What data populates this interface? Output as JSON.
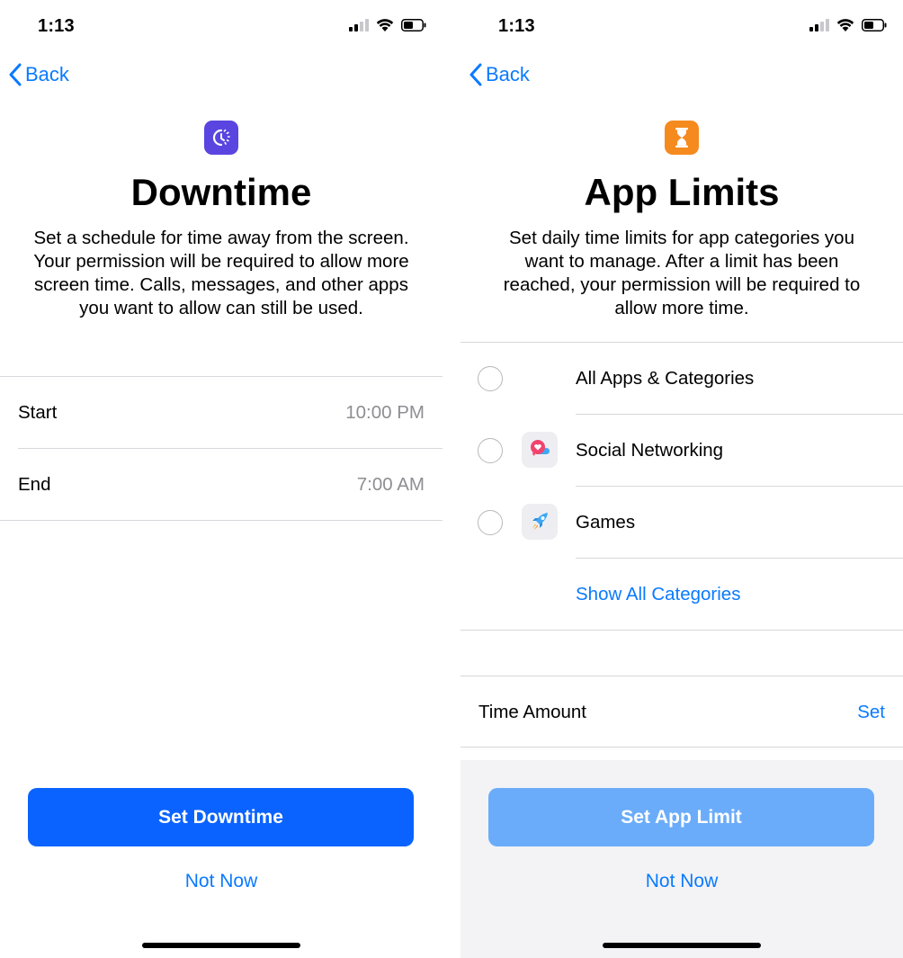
{
  "left_screen": {
    "status": {
      "time": "1:13"
    },
    "nav": {
      "back_label": "Back"
    },
    "icon": {
      "name": "downtime-icon",
      "color": "#5a45e0"
    },
    "title": "Downtime",
    "description": "Set a schedule for time away from the screen. Your permission will be required to allow more screen time. Calls, messages, and other apps you want to allow can still be used.",
    "rows": [
      {
        "label": "Start",
        "value": "10:00 PM"
      },
      {
        "label": "End",
        "value": "7:00 AM"
      }
    ],
    "primary_button": {
      "label": "Set Downtime",
      "color": "#0a63ff"
    },
    "secondary_button": {
      "label": "Not Now"
    }
  },
  "right_screen": {
    "status": {
      "time": "1:13"
    },
    "nav": {
      "back_label": "Back"
    },
    "icon": {
      "name": "hourglass-icon",
      "color": "#f58a1f"
    },
    "title": "App Limits",
    "description": "Set daily time limits for app categories you want to manage. After a limit has been reached, your permission will be required to allow more time.",
    "categories": [
      {
        "label": "All Apps & Categories",
        "icon": ""
      },
      {
        "label": "Social Networking",
        "icon": "social-networking-icon"
      },
      {
        "label": "Games",
        "icon": "games-rocket-icon"
      }
    ],
    "show_all_label": "Show All Categories",
    "time_amount": {
      "label": "Time Amount",
      "value": "Set"
    },
    "primary_button": {
      "label": "Set App Limit",
      "color": "#6aacfa"
    },
    "secondary_button": {
      "label": "Not Now"
    }
  },
  "colors": {
    "accent": "#0a7aff",
    "separator": "#d8d8dc",
    "secondary_text": "#8e8e93"
  }
}
